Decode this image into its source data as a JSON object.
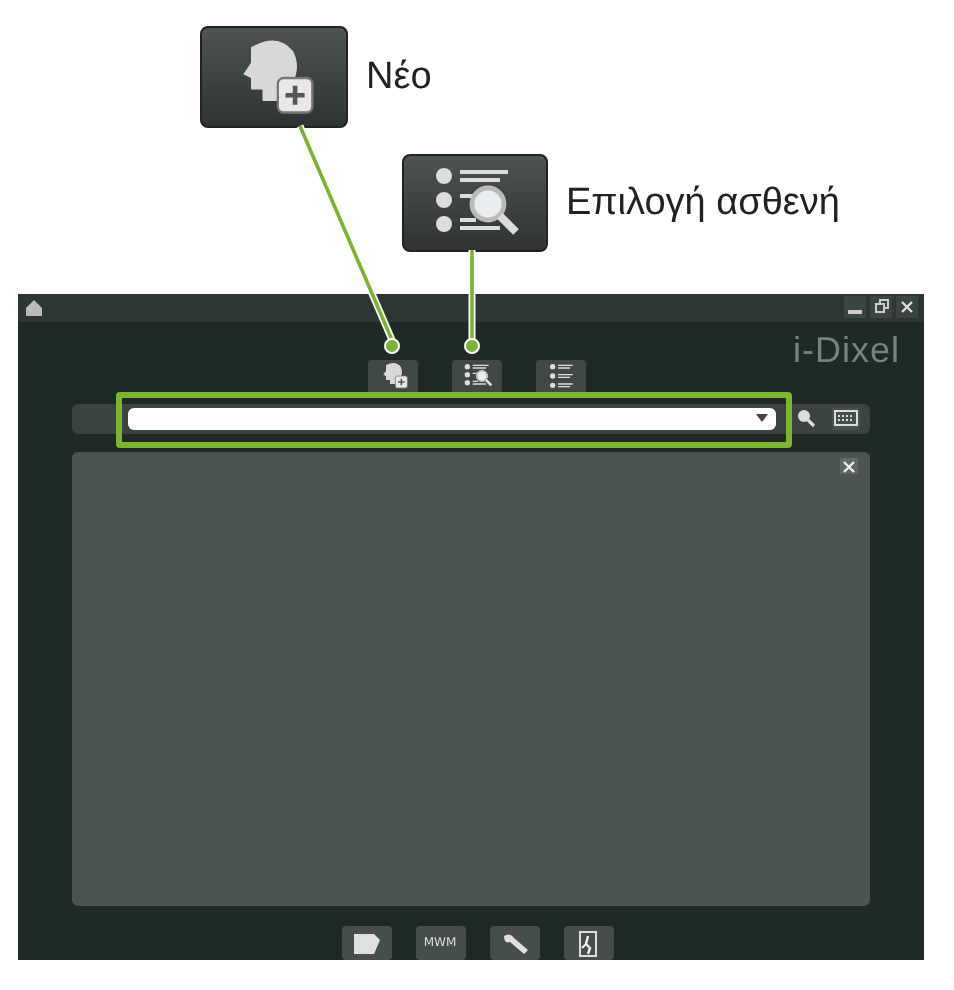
{
  "callouts": [
    {
      "kind": "new-patient",
      "label": "Νέο"
    },
    {
      "kind": "select-patient",
      "label": "Επιλογή ασθενή"
    }
  ],
  "window": {
    "logo": "i-Dixel",
    "toolbar": [
      {
        "kind": "new-patient"
      },
      {
        "kind": "select-patient"
      },
      {
        "kind": "patient-list"
      }
    ],
    "search_field": {
      "highlighted": true
    },
    "bottom_buttons": [
      {
        "kind": "folder"
      },
      {
        "kind": "text",
        "label": "MWM"
      },
      {
        "kind": "wrench"
      },
      {
        "kind": "exit"
      }
    ]
  }
}
